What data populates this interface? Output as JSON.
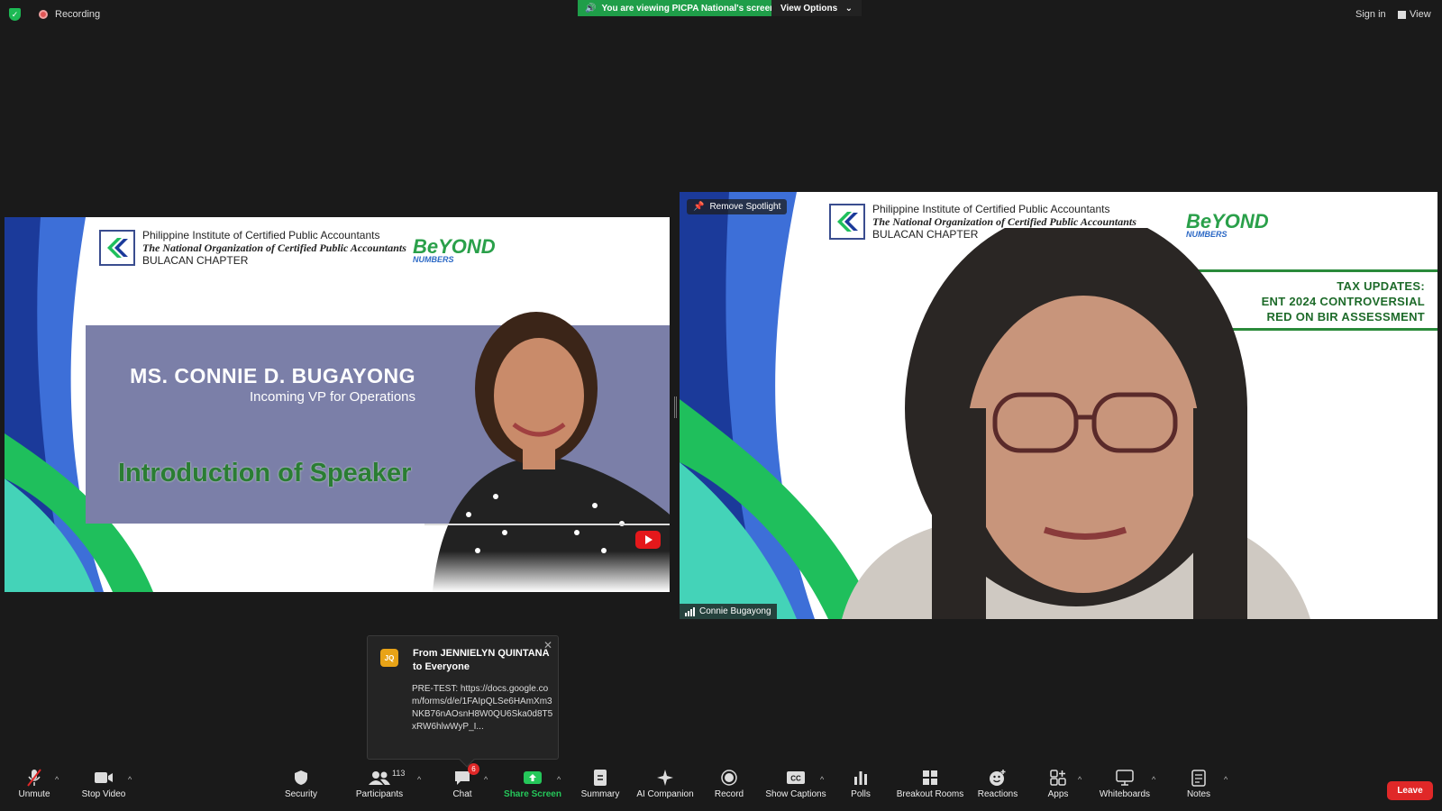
{
  "topbar": {
    "recording": "Recording",
    "viewing_banner": "You are viewing PICPA National's screen",
    "view_options": "View Options",
    "sign_in": "Sign in",
    "view": "View"
  },
  "left_tile": {
    "org_line1": "Philippine Institute of Certified Public Accountants",
    "org_line2": "The National Organization of Certified Public Accountants",
    "org_line3": "BULACAN CHAPTER",
    "speaker_name": "MS. CONNIE D. BUGAYONG",
    "speaker_role": "Incoming VP for Operations",
    "intro": "Introduction of Speaker"
  },
  "right_tile": {
    "spotlight": "Remove Spotlight",
    "org_line1": "Philippine Institute of Certified Public Accountants",
    "org_line2": "The National Organization of Certified Public Accountants",
    "org_line3": "BULACAN CHAPTER",
    "tax_line1": "TAX UPDATES:",
    "tax_line2": "ENT 2024 CONTROVERSIAL",
    "tax_line3": "RED ON BIR ASSESSMENT",
    "participant_name": "Connie Bugayong"
  },
  "chat_popup": {
    "initials": "JQ",
    "from_line1": "From JENNIELYN QUINTANA",
    "from_line2": "to Everyone",
    "message": "PRE-TEST: https://docs.google.com/forms/d/e/1FAIpQLSe6HAmXm3NKB76nAOsnH8W0QU6Ska0d8T5xRW6hlwWyP_I..."
  },
  "toolbar": {
    "unmute": "Unmute",
    "stop_video": "Stop Video",
    "security": "Security",
    "participants": "Participants",
    "participants_count": "113",
    "chat": "Chat",
    "chat_badge": "6",
    "share_screen": "Share Screen",
    "summary": "Summary",
    "ai_companion": "AI Companion",
    "record": "Record",
    "show_captions": "Show Captions",
    "polls": "Polls",
    "breakout_rooms": "Breakout Rooms",
    "reactions": "Reactions",
    "apps": "Apps",
    "whiteboards": "Whiteboards",
    "notes": "Notes",
    "leave": "Leave"
  },
  "colors": {
    "accent_green": "#1f9e49",
    "leave_red": "#e02828",
    "chat_avatar": "#e8a317"
  }
}
